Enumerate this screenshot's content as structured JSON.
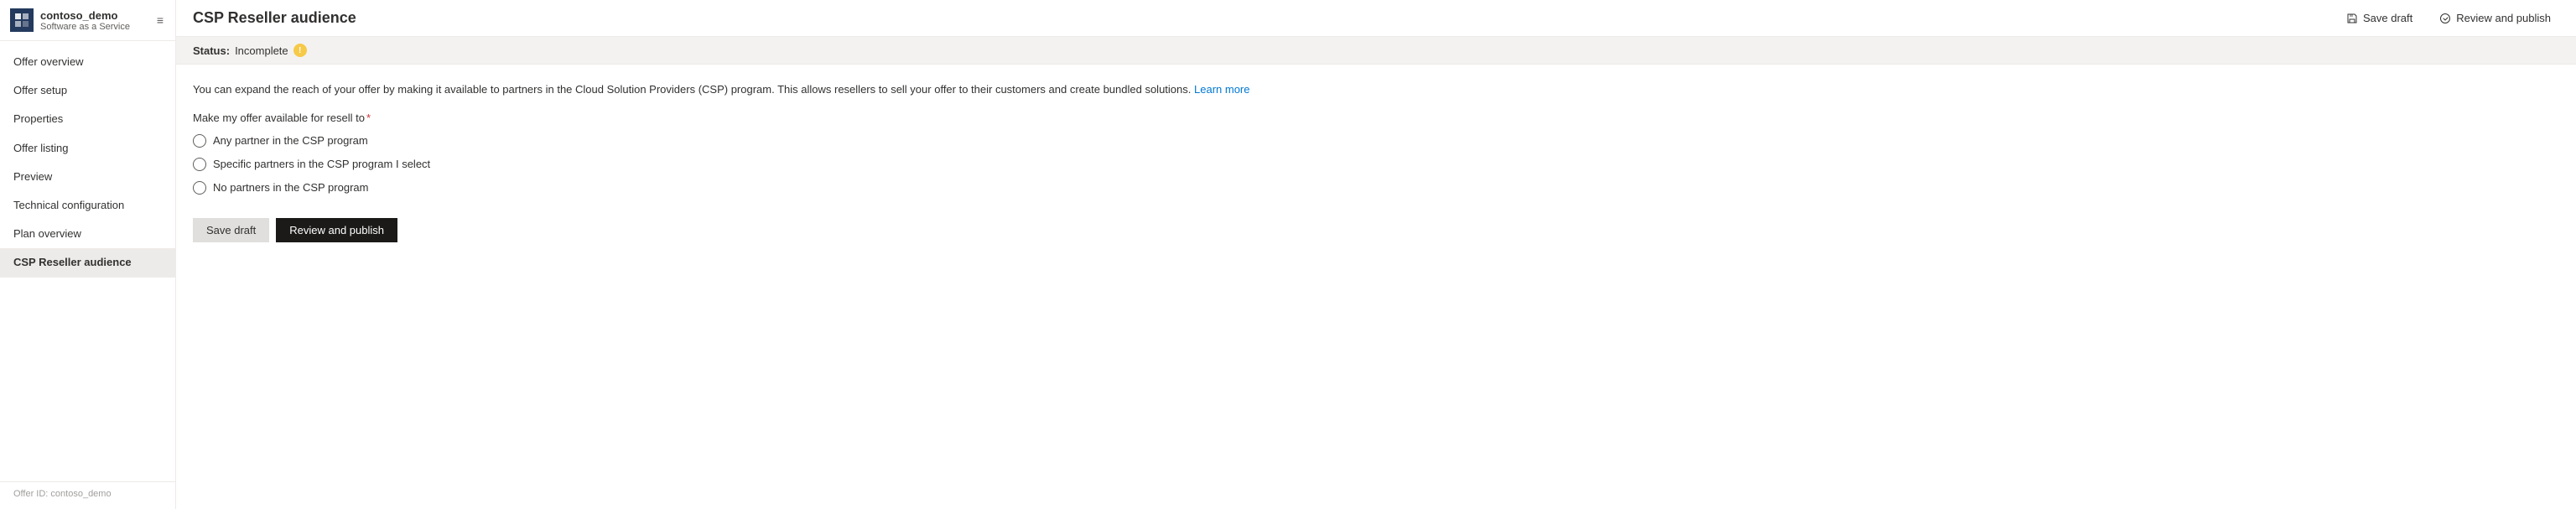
{
  "sidebar": {
    "app_name": "contoso_demo",
    "app_subtitle": "Software as a Service",
    "collapse_icon": "≡",
    "nav_items": [
      {
        "id": "offer-overview",
        "label": "Offer overview",
        "active": false,
        "dimmed": false
      },
      {
        "id": "offer-setup",
        "label": "Offer setup",
        "active": false,
        "dimmed": false
      },
      {
        "id": "properties",
        "label": "Properties",
        "active": false,
        "dimmed": false
      },
      {
        "id": "offer-listing",
        "label": "Offer listing",
        "active": false,
        "dimmed": false
      },
      {
        "id": "preview",
        "label": "Preview",
        "active": false,
        "dimmed": false
      },
      {
        "id": "technical-configuration",
        "label": "Technical configuration",
        "active": false,
        "dimmed": false
      },
      {
        "id": "plan-overview",
        "label": "Plan overview",
        "active": false,
        "dimmed": false
      },
      {
        "id": "csp-reseller-audience",
        "label": "CSP Reseller audience",
        "active": true,
        "dimmed": false
      }
    ],
    "offer_id_label": "Offer ID: contoso_demo"
  },
  "topbar": {
    "page_title": "CSP Reseller audience",
    "save_draft_label": "Save draft",
    "review_publish_label": "Review and publish"
  },
  "status_bar": {
    "status_label": "Status:",
    "status_value": "Incomplete"
  },
  "content": {
    "description": "You can expand the reach of your offer by making it available to partners in the Cloud Solution Providers (CSP) program. This allows resellers to sell your offer to their customers and create bundled solutions.",
    "learn_more_text": "Learn more",
    "field_label": "Make my offer available for resell to",
    "required_marker": "*",
    "radio_options": [
      {
        "id": "any-partner",
        "label": "Any partner in the CSP program",
        "checked": false
      },
      {
        "id": "specific-partners",
        "label": "Specific partners in the CSP program I select",
        "checked": false
      },
      {
        "id": "no-partners",
        "label": "No partners in the CSP program",
        "checked": false
      }
    ],
    "save_draft_button": "Save draft",
    "review_publish_button": "Review and publish"
  }
}
